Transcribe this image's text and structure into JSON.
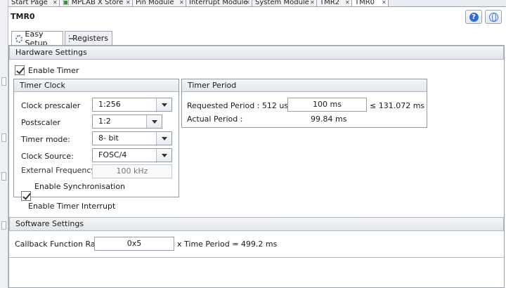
{
  "file_tabs": [
    {
      "label": "Start Page",
      "active": false
    },
    {
      "label": "MPLAB X Store",
      "active": false
    },
    {
      "label": "Pin Module",
      "active": false
    },
    {
      "label": "Interrupt Module",
      "active": false
    },
    {
      "label": "System Module",
      "active": false
    },
    {
      "label": "TMR2",
      "active": false
    },
    {
      "label": "TMR0",
      "active": true
    }
  ],
  "header": {
    "title": "TMR0",
    "help_glyph": "?"
  },
  "setup_tabs": [
    {
      "label": "Easy Setup",
      "icon": "gear-icon",
      "active": true
    },
    {
      "label": "Registers",
      "icon": "list-icon",
      "active": false
    }
  ],
  "hardware": {
    "title": "Hardware Settings",
    "enable_timer": {
      "label": "Enable Timer",
      "checked": true
    },
    "enable_interrupt": {
      "label": "Enable Timer Interrupt",
      "checked": true
    }
  },
  "timer_clock": {
    "title": "Timer Clock",
    "prescaler": {
      "label": "Clock prescaler",
      "value": "1:256"
    },
    "postscaler": {
      "label": "Postscaler",
      "value": "1:2"
    },
    "mode": {
      "label": "Timer mode:",
      "value": "8- bit"
    },
    "source": {
      "label": "Clock Source:",
      "value": "FOSC/4"
    },
    "ext_freq": {
      "label": "External Frequency :",
      "value": "100 kHz"
    },
    "sync": {
      "label": "Enable Synchronisation",
      "checked": true
    }
  },
  "timer_period": {
    "title": "Timer Period",
    "requested_label": "Requested Period : 512 us ≤",
    "requested_value": "100 ms",
    "requested_max": "≤ 131.072 ms",
    "actual_label": "Actual Period :",
    "actual_value": "99.84 ms"
  },
  "software": {
    "title": "Software Settings",
    "callback_label": "Callback Function Rate",
    "callback_value": "0x5",
    "time_period_text": "x Time Period = 499.2 ms"
  },
  "colors": {
    "accent": "#2d6fd1",
    "border": "#9aa3ad",
    "header_bg": "#e2e6eb"
  }
}
